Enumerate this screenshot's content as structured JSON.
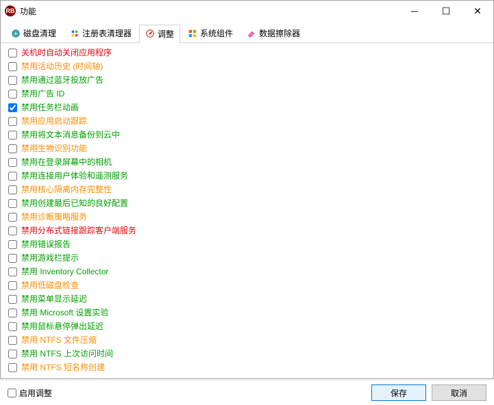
{
  "titlebar": {
    "title": "功能"
  },
  "tabs": [
    {
      "label": "磁盘清理",
      "icon": "disk"
    },
    {
      "label": "注册表清理器",
      "icon": "registry"
    },
    {
      "label": "调整",
      "icon": "tweak"
    },
    {
      "label": "系统组件",
      "icon": "windows"
    },
    {
      "label": "数据擦除器",
      "icon": "eraser"
    }
  ],
  "activeTab": 2,
  "items": [
    {
      "label": "关机时自动关闭应用程序",
      "color": "red",
      "checked": false
    },
    {
      "label": "禁用活动历史 (时间轴)",
      "color": "orange",
      "checked": false
    },
    {
      "label": "禁用通过蓝牙投放广告",
      "color": "green",
      "checked": false
    },
    {
      "label": "禁用广告 ID",
      "color": "green",
      "checked": false
    },
    {
      "label": "禁用任务栏动画",
      "color": "green",
      "checked": true
    },
    {
      "label": "禁用应用启动跟踪",
      "color": "orange",
      "checked": false
    },
    {
      "label": "禁用将文本消息备份到云中",
      "color": "green",
      "checked": false
    },
    {
      "label": "禁用生物识别功能",
      "color": "orange",
      "checked": false
    },
    {
      "label": "禁用在登录屏幕中的相机",
      "color": "green",
      "checked": false
    },
    {
      "label": "禁用连接用户体验和遥测服务",
      "color": "green",
      "checked": false
    },
    {
      "label": "禁用核心隔离内存完整性",
      "color": "orange",
      "checked": false
    },
    {
      "label": "禁用创建最后已知的良好配置",
      "color": "green",
      "checked": false
    },
    {
      "label": "禁用诊断策略服务",
      "color": "orange",
      "checked": false
    },
    {
      "label": "禁用分布式链接跟踪客户端服务",
      "color": "red",
      "checked": false
    },
    {
      "label": "禁用错误报告",
      "color": "green",
      "checked": false
    },
    {
      "label": "禁用游戏栏提示",
      "color": "green",
      "checked": false
    },
    {
      "label": "禁用 Inventory Collector",
      "color": "green",
      "checked": false
    },
    {
      "label": "禁用低磁盘检查",
      "color": "orange",
      "checked": false
    },
    {
      "label": "禁用菜单显示延迟",
      "color": "green",
      "checked": false
    },
    {
      "label": "禁用 Microsoft 设置实验",
      "color": "green",
      "checked": false
    },
    {
      "label": "禁用鼠标悬停弹出延迟",
      "color": "green",
      "checked": false
    },
    {
      "label": "禁用 NTFS 文件压缩",
      "color": "orange",
      "checked": false
    },
    {
      "label": "禁用 NTFS 上次访问时间",
      "color": "green",
      "checked": false
    },
    {
      "label": "禁用 NTFS 短名称创建",
      "color": "orange",
      "checked": false
    }
  ],
  "footer": {
    "enable_label": "启用调整",
    "save_label": "保存",
    "cancel_label": "取消"
  }
}
